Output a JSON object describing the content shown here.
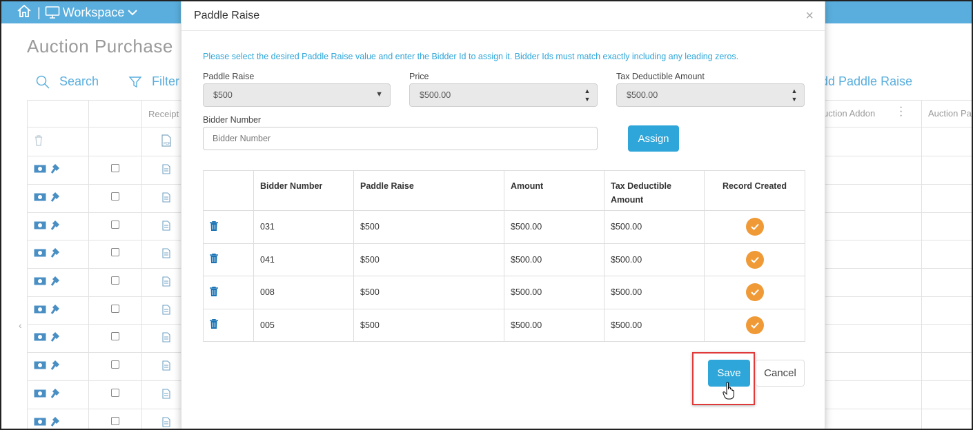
{
  "topbar": {
    "workspace_label": "Workspace",
    "separator": "|"
  },
  "background": {
    "title": "Auction Purchase",
    "search_label": "Search",
    "filter_label": "Filter",
    "add_paddle_label": "dd Paddle Raise",
    "columns": {
      "receipt": "Receipt",
      "auction_addon": "uction Addon",
      "auction_pa": "Auction Pa"
    }
  },
  "modal": {
    "title": "Paddle Raise",
    "close_symbol": "×",
    "instructions": "Please select the desired Paddle Raise value and enter the Bidder Id to assign it. Bidder Ids must match exactly including any leading zeros.",
    "paddle_raise_label": "Paddle Raise",
    "paddle_raise_value": "$500",
    "price_label": "Price",
    "price_value": "$500.00",
    "tax_label": "Tax Deductible Amount",
    "tax_value": "$500.00",
    "bidder_label": "Bidder Number",
    "bidder_placeholder": "Bidder Number",
    "assign_label": "Assign",
    "table": {
      "headers": [
        "Bidder Number",
        "Paddle Raise",
        "Amount",
        "Tax Deductible Amount",
        "Record Created"
      ],
      "rows": [
        {
          "bidder": "031",
          "paddle": "$500",
          "amount": "$500.00",
          "tax": "$500.00"
        },
        {
          "bidder": "041",
          "paddle": "$500",
          "amount": "$500.00",
          "tax": "$500.00"
        },
        {
          "bidder": "008",
          "paddle": "$500",
          "amount": "$500.00",
          "tax": "$500.00"
        },
        {
          "bidder": "005",
          "paddle": "$500",
          "amount": "$500.00",
          "tax": "$500.00"
        }
      ]
    },
    "save_label": "Save",
    "cancel_label": "Cancel"
  },
  "colors": {
    "accent": "#2ea6d9",
    "topbar": "#5aaedd",
    "check": "#f09a37",
    "highlight": "#e03a3a"
  },
  "icons": [
    "home-icon",
    "monitor-icon",
    "chevron-down-icon",
    "search-icon",
    "filter-icon",
    "trash-icon",
    "pdf-icon",
    "money-icon",
    "gavel-icon",
    "document-icon",
    "checkmark-icon",
    "hand-cursor-icon",
    "kebab-menu-icon"
  ]
}
